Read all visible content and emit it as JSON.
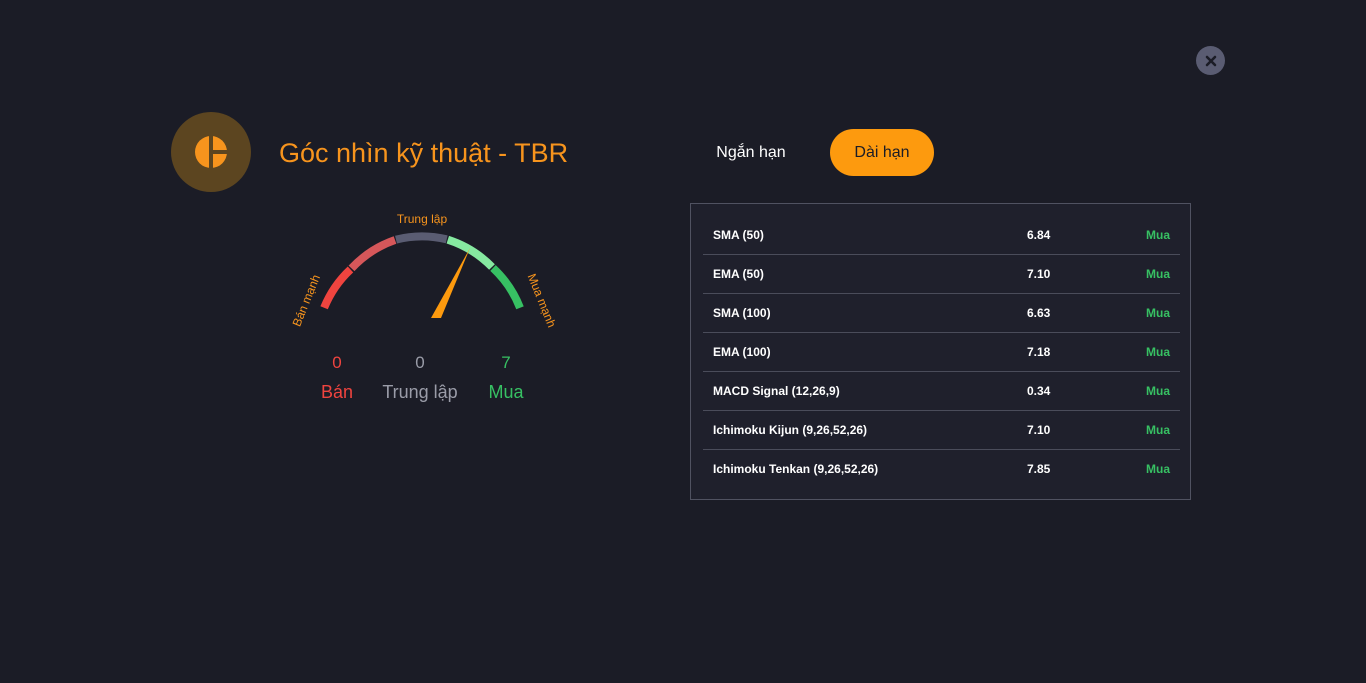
{
  "header": {
    "title": "Góc nhìn kỹ thuật - TBR",
    "close_icon": "close-icon",
    "logo_icon": "pie-chart-icon"
  },
  "tabs": [
    {
      "label": "Ngắn hạn",
      "active": false
    },
    {
      "label": "Dài hạn",
      "active": true
    }
  ],
  "gauge": {
    "label_top": "Trung lập",
    "label_left": "Bán mạnh",
    "label_right": "Mua mạnh",
    "needle_level": 0.71
  },
  "summary": {
    "sell": {
      "count": "0",
      "label": "Bán"
    },
    "neutral": {
      "count": "0",
      "label": "Trung lập"
    },
    "buy": {
      "count": "7",
      "label": "Mua"
    }
  },
  "indicators": [
    {
      "name": "SMA (50)",
      "value": "6.84",
      "signal": "Mua"
    },
    {
      "name": "EMA (50)",
      "value": "7.10",
      "signal": "Mua"
    },
    {
      "name": "SMA (100)",
      "value": "6.63",
      "signal": "Mua"
    },
    {
      "name": "EMA (100)",
      "value": "7.18",
      "signal": "Mua"
    },
    {
      "name": "MACD Signal (12,26,9)",
      "value": "0.34",
      "signal": "Mua"
    },
    {
      "name": "Ichimoku Kijun (9,26,52,26)",
      "value": "7.10",
      "signal": "Mua"
    },
    {
      "name": "Ichimoku Tenkan (9,26,52,26)",
      "value": "7.85",
      "signal": "Mua"
    }
  ],
  "colors": {
    "accent": "#f7941d",
    "sell": "#f0443f",
    "neutral": "#9a9ca8",
    "buy": "#37c063",
    "background": "#1b1c26"
  }
}
